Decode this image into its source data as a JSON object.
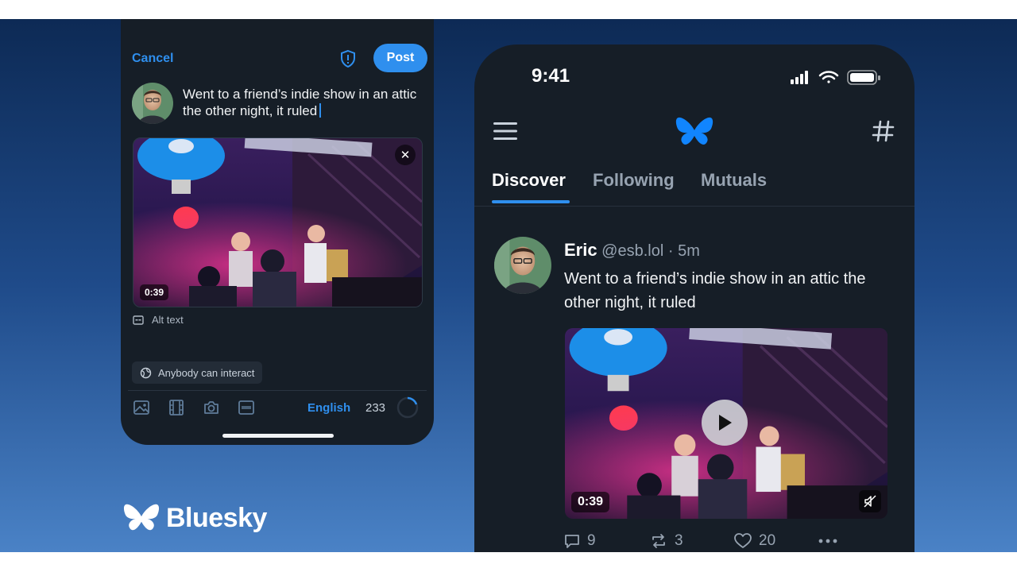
{
  "composer": {
    "cancel_label": "Cancel",
    "post_label": "Post",
    "text": "Went to a friend’s indie show in an attic the other night, it ruled",
    "video_duration": "0:39",
    "alt_text_label": "Alt text",
    "interaction_label": "Anybody can interact",
    "language": "English",
    "chars_remaining": "233",
    "icons": [
      "shield-icon",
      "image-icon",
      "film-icon",
      "camera-icon",
      "gif-icon",
      "close-icon"
    ]
  },
  "feed": {
    "status_time": "9:41",
    "tabs": [
      {
        "label": "Discover",
        "active": true
      },
      {
        "label": "Following",
        "active": false
      },
      {
        "label": "Mutuals",
        "active": false
      }
    ],
    "post": {
      "author_name": "Eric",
      "author_handle": "@esb.lol",
      "separator": "·",
      "time_ago": "5m",
      "text": "Went to a friend’s indie show in an attic the other night, it ruled",
      "video_duration": "0:39",
      "replies": "9",
      "reposts": "3",
      "likes": "20"
    },
    "icons": [
      "menu-icon",
      "butterfly-logo-icon",
      "hashtag-icon",
      "play-icon",
      "mute-icon",
      "reply-icon",
      "repost-icon",
      "heart-icon",
      "more-icon"
    ]
  },
  "brand": {
    "name": "Bluesky",
    "color": "#1185fe"
  },
  "colors": {
    "accent": "#2f8fee",
    "surface": "#161e27",
    "muted_text": "#97a3b1"
  }
}
